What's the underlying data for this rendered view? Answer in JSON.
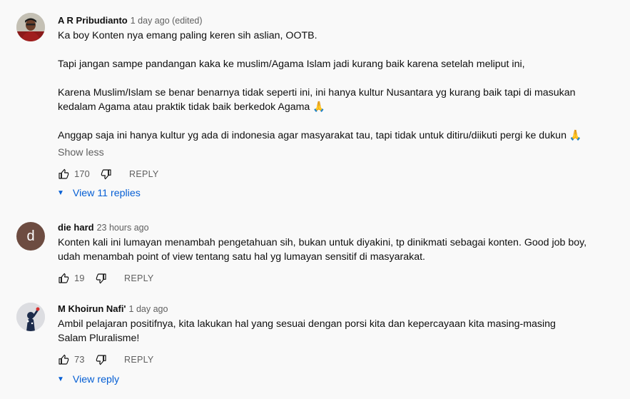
{
  "comments": [
    {
      "author": "A R Pribudianto",
      "timestamp": "1 day ago (edited)",
      "lines": [
        "Ka boy Konten nya emang paling keren sih aslian, OOTB.",
        "Tapi jangan sampe pandangan kaka ke muslim/Agama Islam jadi kurang baik karena setelah meliput ini,",
        "Karena Muslim/Islam se benar benarnya tidak seperti ini, ini hanya kultur Nusantara yg kurang baik tapi di masukan",
        "kedalam Agama atau praktik tidak baik berkedok Agama 🙏",
        "Anggap saja ini hanya kultur yg ada di indonesia agar masyarakat tau, tapi tidak untuk ditiru/diikuti pergi ke dukun 🙏"
      ],
      "show_less": "Show less",
      "likes": "170",
      "reply_label": "REPLY",
      "view_replies": "View 11 replies",
      "avatar_icon": "person-photo-icon"
    },
    {
      "author": "die hard",
      "timestamp": "23 hours ago",
      "avatar_letter": "d",
      "avatar_color": "#6d4c41",
      "lines": [
        "Konten kali ini lumayan menambah pengetahuan sih, bukan untuk diyakini, tp dinikmati sebagai konten. Good job boy,",
        "udah menambah point of view tentang satu hal yg lumayan sensitif di masyarakat."
      ],
      "likes": "19",
      "reply_label": "REPLY"
    },
    {
      "author": "M Khoirun Nafi'",
      "timestamp": "1 day ago",
      "lines": [
        "Ambil pelajaran positifnya, kita lakukan hal yang sesuai dengan porsi kita dan kepercayaan kita masing-masing",
        "Salam Pluralisme!"
      ],
      "likes": "73",
      "reply_label": "REPLY",
      "view_replies": "View reply",
      "avatar_icon": "figure-photo-icon"
    }
  ],
  "colors": {
    "background": "#f9f9f9",
    "link_blue": "#065fd4",
    "secondary_text": "#606060"
  },
  "icons": {
    "like": "thumbs-up-icon",
    "dislike": "thumbs-down-icon",
    "expand": "caret-down-icon"
  }
}
